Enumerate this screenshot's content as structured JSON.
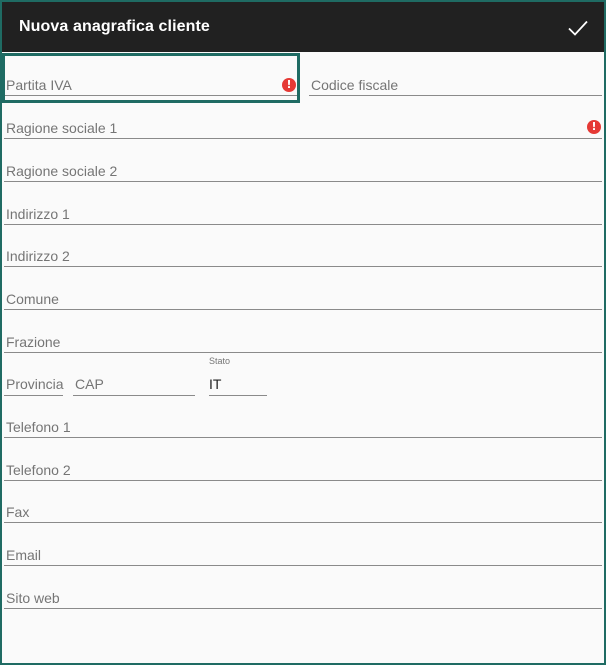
{
  "appbar": {
    "title": "Nuova anagrafica cliente",
    "confirm_icon": "check-icon"
  },
  "fields": {
    "partita_iva": {
      "placeholder": "Partita IVA",
      "error": true
    },
    "codice_fiscale": {
      "placeholder": "Codice fiscale"
    },
    "ragione_sociale_1": {
      "placeholder": "Ragione sociale 1",
      "error": true
    },
    "ragione_sociale_2": {
      "placeholder": "Ragione sociale 2"
    },
    "indirizzo_1": {
      "placeholder": "Indirizzo 1"
    },
    "indirizzo_2": {
      "placeholder": "Indirizzo 2"
    },
    "comune": {
      "placeholder": "Comune"
    },
    "frazione": {
      "placeholder": "Frazione"
    },
    "provincia": {
      "placeholder": "Provincia"
    },
    "cap": {
      "placeholder": "CAP"
    },
    "stato": {
      "label": "Stato",
      "value": "IT"
    },
    "telefono_1": {
      "placeholder": "Telefono 1"
    },
    "telefono_2": {
      "placeholder": "Telefono 2"
    },
    "fax": {
      "placeholder": "Fax"
    },
    "email": {
      "placeholder": "Email"
    },
    "sito_web": {
      "placeholder": "Sito web"
    }
  },
  "error_glyph": "!",
  "colors": {
    "appbar": "#212121",
    "accent": "#1f6b63",
    "error": "#e53935"
  }
}
